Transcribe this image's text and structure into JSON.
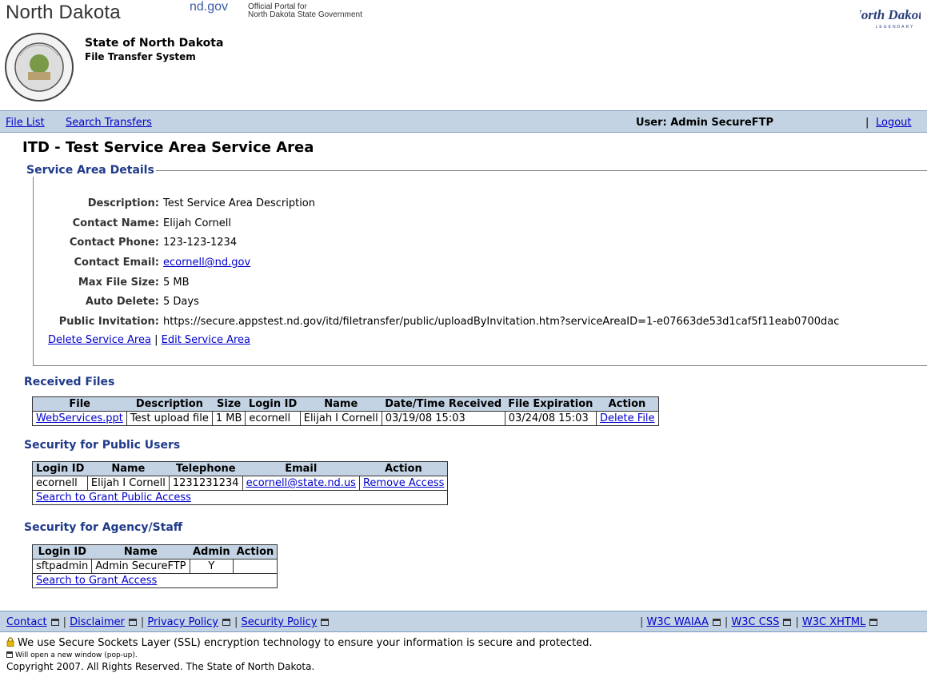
{
  "header": {
    "state_title": "North Dakota",
    "ndgov": "nd.gov",
    "portal_line1": "Official Portal for",
    "portal_line2": "North Dakota State Government",
    "org_name": "State of North Dakota",
    "system_name": "File Transfer System",
    "seal_text": "GREAT SEAL STATE OF NORTH DAKOTA",
    "logo_text": "North Dakota",
    "logo_subtext": "LEGENDARY"
  },
  "nav": {
    "file_list": "File List",
    "search_transfers": "Search Transfers",
    "user": "User: Admin SecureFTP",
    "separator": "|",
    "logout": "Logout"
  },
  "page_title": "ITD - Test Service Area Service Area",
  "details": {
    "legend": "Service Area Details",
    "fields": [
      {
        "label": "Description:",
        "value": "Test Service Area Description"
      },
      {
        "label": "Contact Name:",
        "value": "Elijah Cornell"
      },
      {
        "label": "Contact Phone:",
        "value": "123-123-1234"
      },
      {
        "label": "Contact Email:",
        "value": "ecornell@nd.gov"
      },
      {
        "label": "Max File Size:",
        "value": "5 MB"
      },
      {
        "label": "Auto Delete:",
        "value": "5 Days"
      },
      {
        "label": "Public Invitation:",
        "value": "https://secure.appstest.nd.gov/itd/filetransfer/public/uploadByInvitation.htm?serviceAreaID=1-e07663de53d1caf5f11eab0700dac"
      }
    ],
    "delete_link": "Delete Service Area",
    "link_sep": "|",
    "edit_link": "Edit Service Area"
  },
  "received": {
    "title": "Received Files",
    "headers": [
      "File",
      "Description",
      "Size",
      "Login ID",
      "Name",
      "Date/Time Received",
      "File Expiration",
      "Action"
    ],
    "rows": [
      [
        "WebServices.ppt",
        "Test upload file",
        "1 MB",
        "ecornell",
        "Elijah I Cornell",
        "03/19/08 15:03",
        "03/24/08 15:03",
        "Delete File"
      ]
    ]
  },
  "public_security": {
    "title": "Security for Public Users",
    "headers": [
      "Login ID",
      "Name",
      "Telephone",
      "Email",
      "Action"
    ],
    "rows": [
      [
        "ecornell",
        "Elijah I Cornell",
        "1231231234",
        "ecornell@state.nd.us",
        "Remove Access"
      ]
    ],
    "grant_link": "Search to Grant Public Access"
  },
  "agency_security": {
    "title": "Security for Agency/Staff",
    "headers": [
      "Login ID",
      "Name",
      "Admin",
      "Action"
    ],
    "rows": [
      [
        "sftpadmin",
        "Admin SecureFTP",
        "Y",
        ""
      ]
    ],
    "grant_link": "Search to Grant Access"
  },
  "footer": {
    "contact": "Contact",
    "disclaimer": "Disclaimer",
    "privacy": "Privacy Policy",
    "security": "Security Policy",
    "waiaa": "W3C WAIAA",
    "css": "W3C CSS",
    "xhtml": "W3C XHTML",
    "separator": "|",
    "ssl_text": "We use Secure Sockets Layer (SSL) encryption technology to ensure your information is secure and protected.",
    "popup_note": "Will open a new window (pop-up).",
    "copyright": "Copyright 2007. All Rights Reserved. The State of North Dakota."
  },
  "colors": {
    "nav_bg": "#c3d3e3",
    "section_title": "#1f3a8a",
    "link": "#0000cc"
  }
}
